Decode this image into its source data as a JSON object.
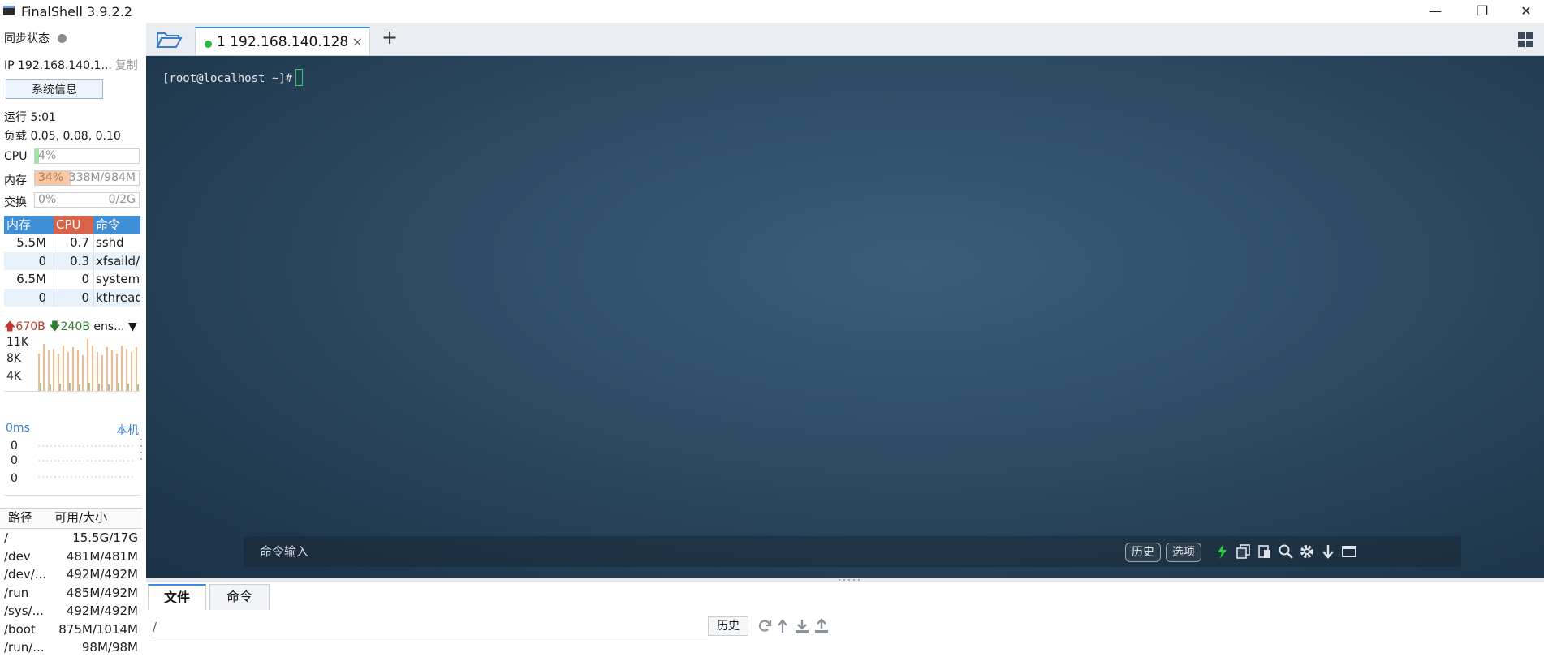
{
  "window": {
    "title": "FinalShell 3.9.2.2",
    "minimize": "—",
    "restore": "❐",
    "close": "✕"
  },
  "sidebar": {
    "sync_label": "同步状态",
    "ip_label": "IP 192.168.140.1...",
    "copy_label": "复制",
    "sysinfo_button": "系统信息",
    "uptime": "运行 5:01",
    "load": "负载 0.05, 0.08, 0.10",
    "meters": [
      {
        "label": "CPU",
        "value": "4%",
        "right": "",
        "fraction": 0.04,
        "color": "#9be3a0"
      },
      {
        "label": "内存",
        "value": "34%",
        "right": "338M/984M",
        "fraction": 0.34,
        "color": "#f6c8a8"
      },
      {
        "label": "交换",
        "value": "0%",
        "right": "0/2G",
        "fraction": 0.0,
        "color": "#9be3a0"
      }
    ],
    "process_table": {
      "headers": {
        "mem": "内存",
        "cpu": "CPU",
        "cmd": "命令"
      },
      "header_colors": {
        "mem": "#3f8ed8",
        "cpu": "#d9624b",
        "cmd": "#3f8ed8"
      },
      "rows": [
        {
          "mem": "5.5M",
          "cpu": "0.7",
          "cmd": "sshd"
        },
        {
          "mem": "0",
          "cpu": "0.3",
          "cmd": "xfsaild/d"
        },
        {
          "mem": "6.5M",
          "cpu": "0",
          "cmd": "systemd"
        },
        {
          "mem": "0",
          "cpu": "0",
          "cmd": "kthreadd"
        }
      ]
    },
    "network": {
      "up": "670B",
      "down": "240B",
      "interface": "ens...",
      "axis": [
        "11K",
        "8K",
        "4K"
      ]
    },
    "ping": {
      "latency": "0ms",
      "target": "本机",
      "values": [
        "0",
        "0",
        "0"
      ]
    },
    "disk_table": {
      "headers": {
        "path": "路径",
        "size": "可用/大小"
      },
      "rows": [
        {
          "path": "/",
          "size": "15.5G/17G"
        },
        {
          "path": "/dev",
          "size": "481M/481M"
        },
        {
          "path": "/dev/...",
          "size": "492M/492M"
        },
        {
          "path": "/run",
          "size": "485M/492M"
        },
        {
          "path": "/sys/...",
          "size": "492M/492M"
        },
        {
          "path": "/boot",
          "size": "875M/1014M"
        },
        {
          "path": "/run/...",
          "size": "98M/98M"
        }
      ]
    }
  },
  "tabs": {
    "active_label": "1 192.168.140.128",
    "close": "×",
    "add": "+"
  },
  "terminal": {
    "prompt": "[root@localhost ~]#",
    "command_placeholder": "命令输入",
    "history_button": "历史",
    "options_button": "选项"
  },
  "bottom": {
    "tab_files": "文件",
    "tab_commands": "命令",
    "path_value": "/",
    "history_button": "历史"
  }
}
